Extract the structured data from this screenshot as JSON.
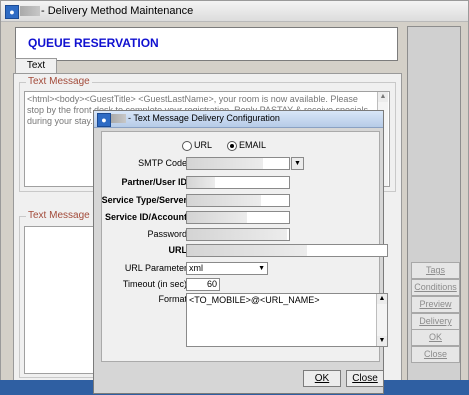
{
  "main_window": {
    "title": "- Delivery Method Maintenance",
    "heading": "QUEUE RESERVATION",
    "tab_label": "Text Msg.",
    "text_message_group_label": "Text Message",
    "text_message_body": "<html><body><GuestTitle> <GuestLastName>, your room is now available.  Please stop by the front desk to complete your registration. Reply PASTAY & receive specials during your stay. Thank you very muc",
    "preview_group_label": "Text Message Previ"
  },
  "side_buttons": [
    {
      "label": "Tags"
    },
    {
      "label": "Conditions"
    },
    {
      "label": "Preview"
    },
    {
      "label": "Delivery"
    },
    {
      "label": "OK"
    },
    {
      "label": "Close"
    }
  ],
  "dialog": {
    "title": "- Text Message Delivery Configuration",
    "radio_url_label": "URL",
    "radio_email_label": "EMAIL",
    "selected_mode": "EMAIL",
    "smtp_code_label": "SMTP Code",
    "partner_user_id_label": "Partner/User ID",
    "service_type_server_label": "Service Type/Server",
    "service_id_account_label": "Service ID/Account",
    "password_label": "Password",
    "url_label": "URL",
    "url_parameter_label": "URL Parameter",
    "url_parameter_value": "xml",
    "timeout_label": "Timeout (in sec)",
    "timeout_value": "60",
    "format_label": "Format",
    "format_value": "<TO_MOBILE>@<URL_NAME>",
    "ok_label": "OK",
    "close_label": "Close"
  },
  "icons": {
    "app_icon": "window-app-icon",
    "dropdown": "chevron-down-icon",
    "scroll_up": "scroll-up-arrow-icon",
    "scroll_down": "scroll-down-arrow-icon"
  },
  "colors": {
    "heading": "#1010d0",
    "group_label": "#a34b3a",
    "taskbar": "#2f5fa2"
  }
}
